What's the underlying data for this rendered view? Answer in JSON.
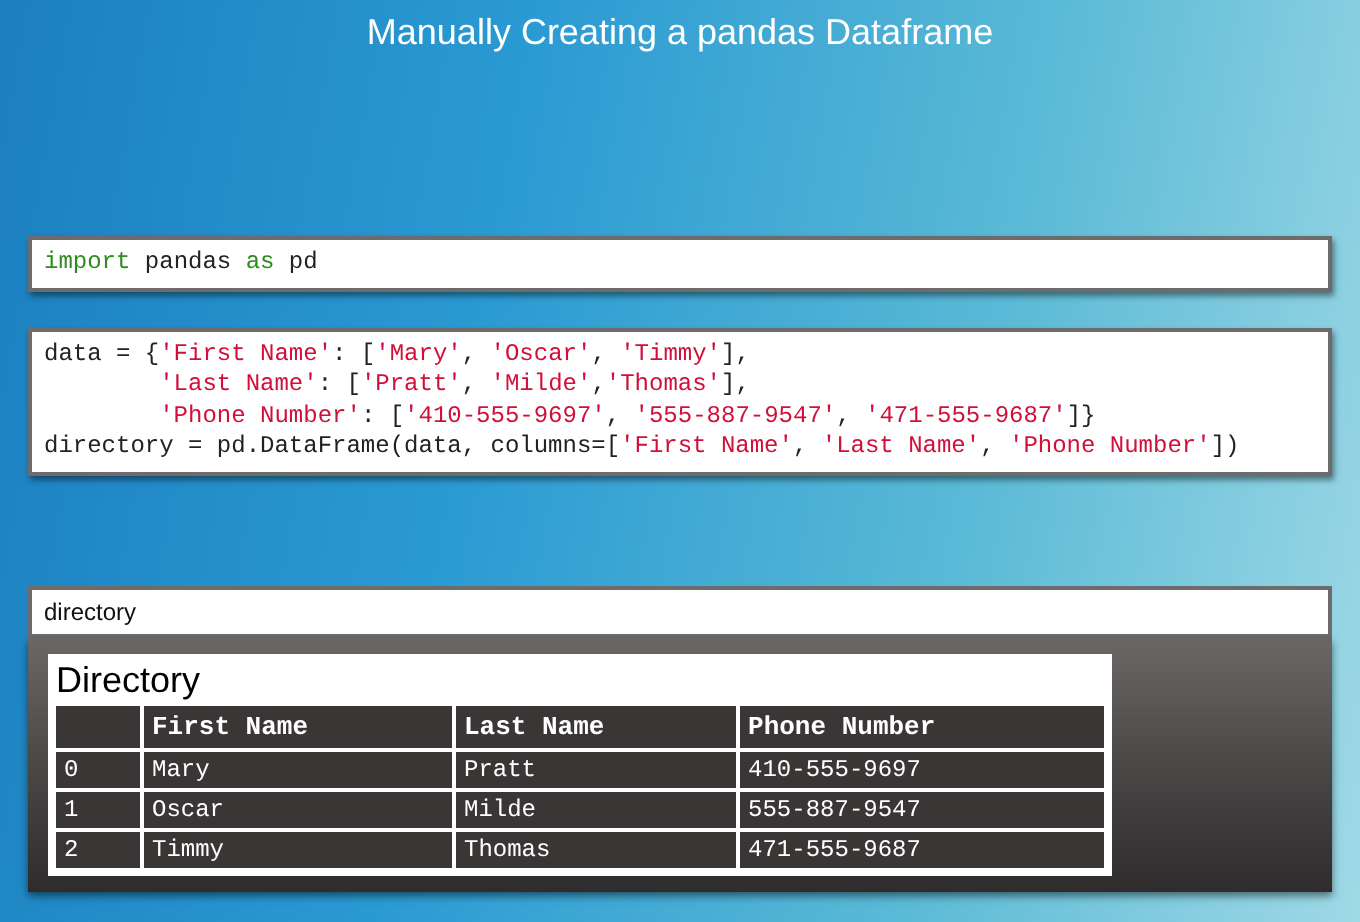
{
  "title": "Manually Creating a pandas Dataframe",
  "cells": [
    {
      "kind": "code",
      "lines": [
        {
          "indent": false,
          "tokens": [
            {
              "kind": "keyword",
              "text": "import"
            },
            {
              "kind": "plain",
              "text": " pandas "
            },
            {
              "kind": "keyword",
              "text": "as"
            },
            {
              "kind": "plain",
              "text": " pd"
            }
          ]
        }
      ]
    },
    {
      "kind": "code",
      "lines": [
        {
          "indent": false,
          "tokens": [
            {
              "kind": "plain",
              "text": "data = {"
            },
            {
              "kind": "string",
              "text": "'First Name'"
            },
            {
              "kind": "plain",
              "text": ": ["
            },
            {
              "kind": "string",
              "text": "'Mary'"
            },
            {
              "kind": "plain",
              "text": ", "
            },
            {
              "kind": "string",
              "text": "'Oscar'"
            },
            {
              "kind": "plain",
              "text": ", "
            },
            {
              "kind": "string",
              "text": "'Timmy'"
            },
            {
              "kind": "plain",
              "text": "],"
            }
          ]
        },
        {
          "indent": true,
          "tokens": [
            {
              "kind": "string",
              "text": "'Last Name'"
            },
            {
              "kind": "plain",
              "text": ": ["
            },
            {
              "kind": "string",
              "text": "'Pratt'"
            },
            {
              "kind": "plain",
              "text": ", "
            },
            {
              "kind": "string",
              "text": "'Milde'"
            },
            {
              "kind": "plain",
              "text": ","
            },
            {
              "kind": "string",
              "text": "'Thomas'"
            },
            {
              "kind": "plain",
              "text": "],"
            }
          ]
        },
        {
          "indent": true,
          "tokens": [
            {
              "kind": "string",
              "text": "'Phone Number'"
            },
            {
              "kind": "plain",
              "text": ": ["
            },
            {
              "kind": "string",
              "text": "'410-555-9697'"
            },
            {
              "kind": "plain",
              "text": ", "
            },
            {
              "kind": "string",
              "text": "'555-887-9547'"
            },
            {
              "kind": "plain",
              "text": ", "
            },
            {
              "kind": "string",
              "text": "'471-555-9687'"
            },
            {
              "kind": "plain",
              "text": "]}"
            }
          ]
        },
        {
          "indent": false,
          "tokens": [
            {
              "kind": "plain",
              "text": "directory = pd.DataFrame(data, columns=["
            },
            {
              "kind": "string",
              "text": "'First Name'"
            },
            {
              "kind": "plain",
              "text": ", "
            },
            {
              "kind": "string",
              "text": "'Last Name'"
            },
            {
              "kind": "plain",
              "text": ", "
            },
            {
              "kind": "string",
              "text": "'Phone Number'"
            },
            {
              "kind": "plain",
              "text": "])"
            }
          ]
        }
      ]
    },
    {
      "kind": "output",
      "input": "directory",
      "table": {
        "caption": "Directory",
        "columns": [
          "First Name",
          "Last Name",
          "Phone Number"
        ],
        "rows": [
          {
            "index": "0",
            "cells": [
              "Mary",
              "Pratt",
              "410-555-9697"
            ]
          },
          {
            "index": "1",
            "cells": [
              "Oscar",
              "Milde",
              "555-887-9547"
            ]
          },
          {
            "index": "2",
            "cells": [
              "Timmy",
              "Thomas",
              "471-555-9687"
            ]
          }
        ]
      }
    }
  ]
}
